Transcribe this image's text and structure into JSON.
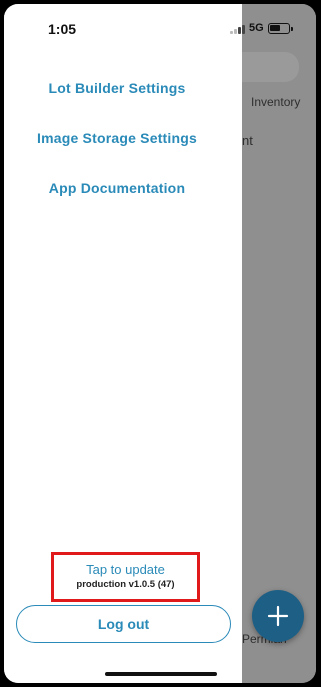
{
  "status_bar": {
    "time": "1:05",
    "network": "5G",
    "signal_icon": "signal-bars-icon",
    "battery_icon": "battery-icon"
  },
  "drawer": {
    "menu_items": [
      {
        "label": "Lot Builder Settings"
      },
      {
        "label": "Image Storage Settings"
      },
      {
        "label": "App Documentation"
      }
    ],
    "update": {
      "label": "Tap to update",
      "version": "production v1.0.5 (47)"
    },
    "logout_label": "Log out"
  },
  "background": {
    "tab_label": "Inventory",
    "partial_text": "nt",
    "partial_bottom_text": "Permian",
    "fab_icon": "plus-icon"
  },
  "colors": {
    "accent": "#2a8ab8",
    "highlight_border": "#e01a1a",
    "fab": "#1e5f85"
  }
}
